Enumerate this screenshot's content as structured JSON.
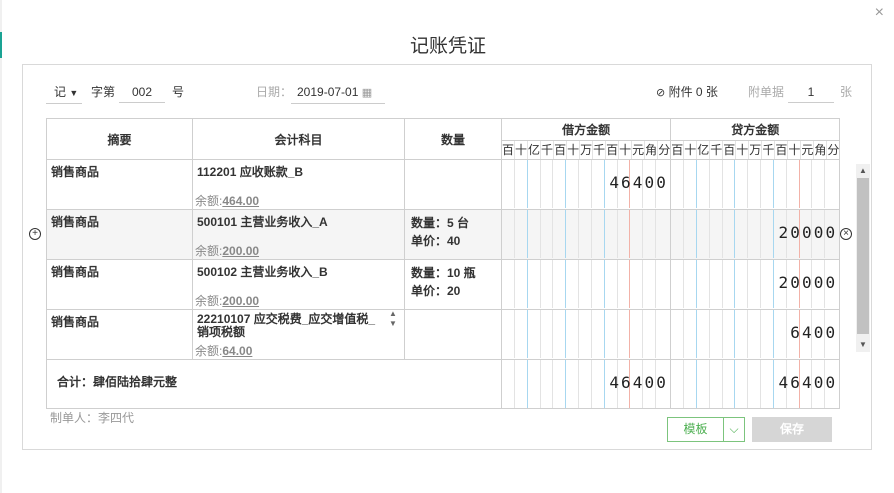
{
  "dialog": {
    "title": "记账凭证",
    "close_symbol": "×"
  },
  "header": {
    "voucher_type": "记",
    "word_label": "字第",
    "number": "002",
    "number_suffix": "号",
    "date_label": "日期：",
    "date_value": "2019-07-01",
    "attachment_label": "附件 0 张",
    "attached_docs_label": "附单据",
    "attached_docs_value": "1",
    "attached_docs_unit": "张"
  },
  "columns": {
    "summary": "摘要",
    "account": "会计科目",
    "quantity": "数量",
    "debit": "借方金额",
    "credit": "贷方金额",
    "digits": [
      "百",
      "十",
      "亿",
      "千",
      "百",
      "十",
      "万",
      "千",
      "百",
      "十",
      "元",
      "角",
      "分"
    ]
  },
  "rows": [
    {
      "summary": "销售商品",
      "account": "112201 应收账款_B",
      "balance_label": "余额:",
      "balance": "464.00",
      "qty": "",
      "price": "",
      "debit": "46400",
      "credit": ""
    },
    {
      "summary": "销售商品",
      "account": "500101 主营业务收入_A",
      "balance_label": "余额:",
      "balance": "200.00",
      "qty": "数量：5 台",
      "price": "单价：40",
      "debit": "",
      "credit": "20000"
    },
    {
      "summary": "销售商品",
      "account": "500102 主营业务收入_B",
      "balance_label": "余额:",
      "balance": "200.00",
      "qty": "数量：10 瓶",
      "price": "单价：20",
      "debit": "",
      "credit": "20000"
    },
    {
      "summary": "销售商品",
      "account": "22210107 应交税费_应交增值税_销项税额",
      "balance_label": "余额:",
      "balance": "64.00",
      "qty": "",
      "price": "",
      "debit": "",
      "credit": "6400"
    }
  ],
  "total": {
    "label": "合计：肆佰陆拾肆元整",
    "debit": "46400",
    "credit": "46400"
  },
  "footer": {
    "maker": "制单人：李四代",
    "template_button": "模板",
    "save_button": "保存"
  }
}
